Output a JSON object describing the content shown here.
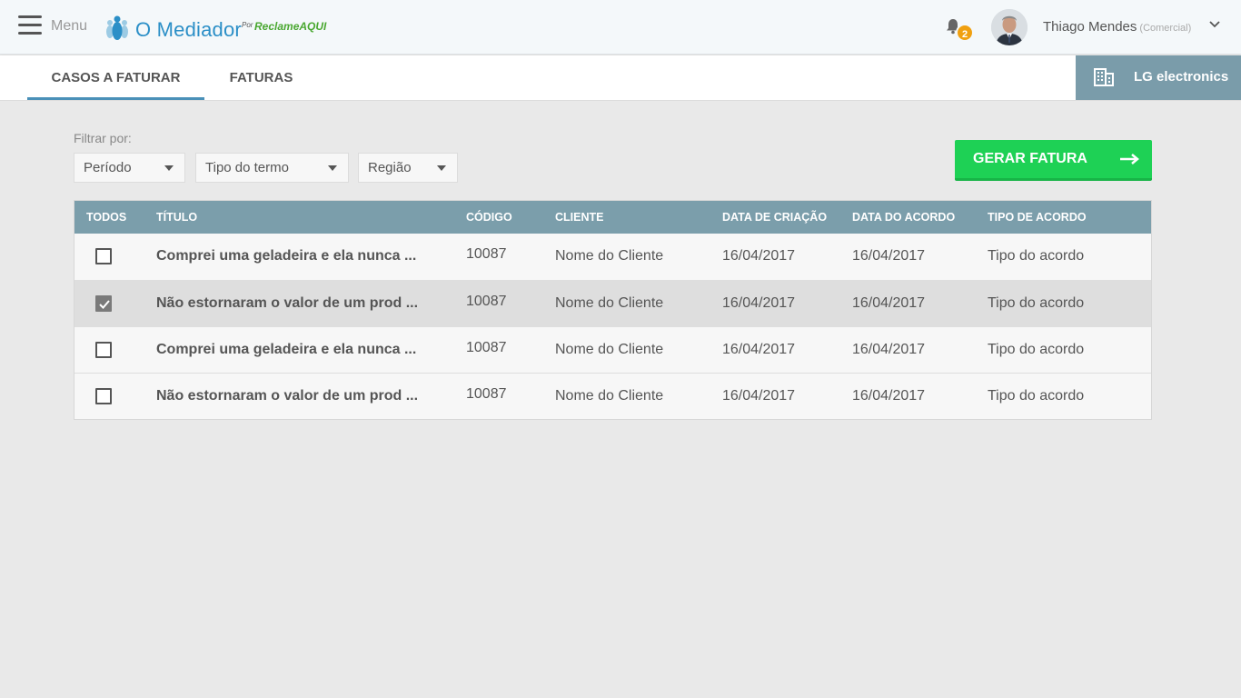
{
  "header": {
    "menu_label": "Menu",
    "logo_text": "O Mediador",
    "logo_por": "Por",
    "logo_brand": "ReclameAQUI",
    "notification_count": "2",
    "user_name": "Thiago Mendes",
    "user_role": "(Comercial)"
  },
  "tabs": [
    {
      "label": "CASOS A FATURAR",
      "active": true
    },
    {
      "label": "FATURAS",
      "active": false
    }
  ],
  "company": {
    "name": "LG electronics",
    "icon": "building-icon"
  },
  "filters": {
    "label": "Filtrar por:",
    "periodo": "Período",
    "tipo_termo": "Tipo do termo",
    "regiao": "Região"
  },
  "actions": {
    "gerar_fatura": "GERAR FATURA"
  },
  "table": {
    "headers": {
      "todos": "TODOS",
      "titulo": "TÍTULO",
      "codigo": "CÓDIGO",
      "cliente": "CLIENTE",
      "data_criacao": "DATA DE CRIAÇÃO",
      "data_acordo": "DATA DO ACORDO",
      "tipo_acordo": "TIPO DE ACORDO"
    },
    "rows": [
      {
        "checked": false,
        "titulo": "Comprei uma geladeira e ela nunca ...",
        "codigo": "10087",
        "cliente": "Nome do Cliente",
        "data_criacao": "16/04/2017",
        "data_acordo": "16/04/2017",
        "tipo_acordo": "Tipo do acordo"
      },
      {
        "checked": true,
        "titulo": "Não estornaram o valor de um prod ...",
        "codigo": "10087",
        "cliente": "Nome do Cliente",
        "data_criacao": "16/04/2017",
        "data_acordo": "16/04/2017",
        "tipo_acordo": "Tipo do acordo"
      },
      {
        "checked": false,
        "titulo": "Comprei uma geladeira e ela nunca ...",
        "codigo": "10087",
        "cliente": "Nome do Cliente",
        "data_criacao": "16/04/2017",
        "data_acordo": "16/04/2017",
        "tipo_acordo": "Tipo do acordo"
      },
      {
        "checked": false,
        "titulo": "Não estornaram o valor de um prod ...",
        "codigo": "10087",
        "cliente": "Nome do Cliente",
        "data_criacao": "16/04/2017",
        "data_acordo": "16/04/2017",
        "tipo_acordo": "Tipo do acordo"
      }
    ]
  },
  "colors": {
    "brand_blue": "#2b8fc7",
    "header_row": "#7b9eab",
    "company_bg": "#7a9caa",
    "primary_green": "#1ed155",
    "badge_orange": "#f0a010"
  }
}
